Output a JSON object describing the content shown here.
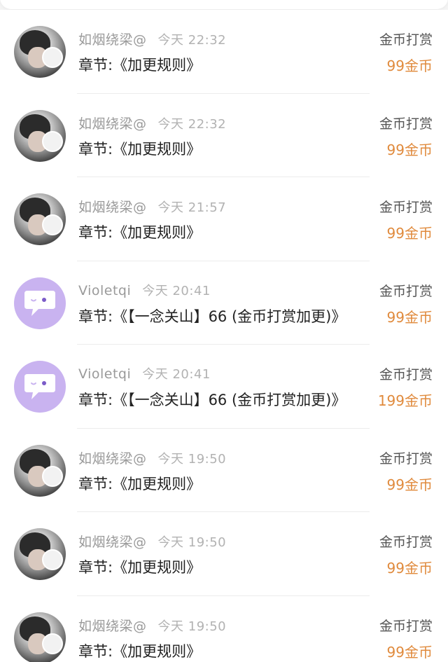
{
  "records": [
    {
      "name": "如烟绕梁@",
      "time": "今天 22:32",
      "chapter": "章节:《加更规则》",
      "type": "金币打赏",
      "amount": "99金币",
      "avatar": "photo"
    },
    {
      "name": "如烟绕梁@",
      "time": "今天 22:32",
      "chapter": "章节:《加更规则》",
      "type": "金币打赏",
      "amount": "99金币",
      "avatar": "photo"
    },
    {
      "name": "如烟绕梁@",
      "time": "今天 21:57",
      "chapter": "章节:《加更规则》",
      "type": "金币打赏",
      "amount": "99金币",
      "avatar": "photo"
    },
    {
      "name": "Violetqi",
      "time": "今天 20:41",
      "chapter": "章节:《【一念关山】66 (金币打赏加更)》",
      "type": "金币打赏",
      "amount": "99金币",
      "avatar": "bubble"
    },
    {
      "name": "Violetqi",
      "time": "今天 20:41",
      "chapter": "章节:《【一念关山】66 (金币打赏加更)》",
      "type": "金币打赏",
      "amount": "199金币",
      "avatar": "bubble"
    },
    {
      "name": "如烟绕梁@",
      "time": "今天 19:50",
      "chapter": "章节:《加更规则》",
      "type": "金币打赏",
      "amount": "99金币",
      "avatar": "photo"
    },
    {
      "name": "如烟绕梁@",
      "time": "今天 19:50",
      "chapter": "章节:《加更规则》",
      "type": "金币打赏",
      "amount": "99金币",
      "avatar": "photo"
    },
    {
      "name": "如烟绕梁@",
      "time": "今天 19:50",
      "chapter": "章节:《加更规则》",
      "type": "金币打赏",
      "amount": "99金币",
      "avatar": "photo"
    }
  ],
  "colors": {
    "amount": "#e08a3c",
    "bubble_avatar": "#c9b3f0"
  }
}
